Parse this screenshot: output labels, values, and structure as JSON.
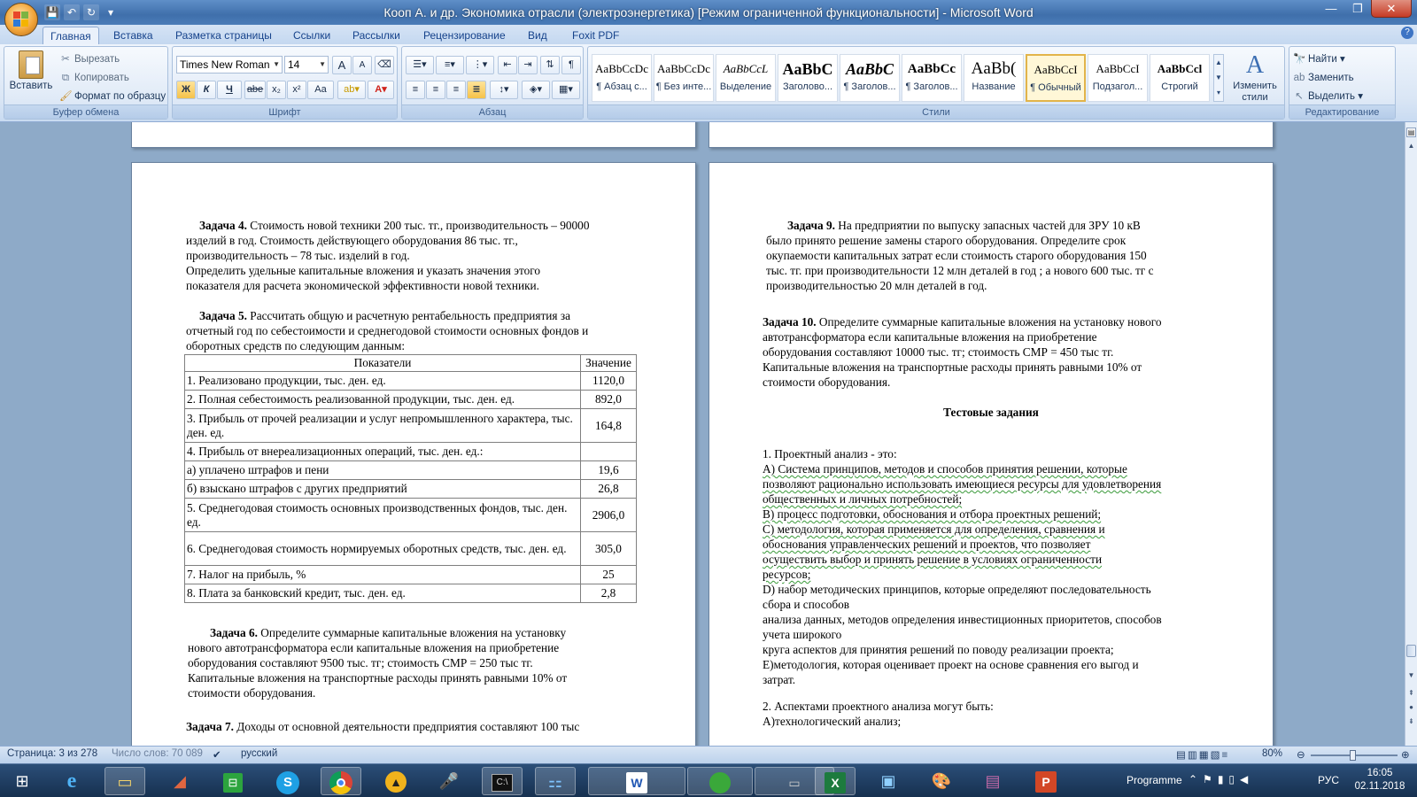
{
  "window": {
    "title": "Кооп А. и др. Экономика отрасли (электроэнергетика) [Режим ограниченной функциональности] - Microsoft Word",
    "minimize": "—",
    "restore": "❐",
    "close": "✕"
  },
  "tabs": [
    "Главная",
    "Вставка",
    "Разметка страницы",
    "Ссылки",
    "Рассылки",
    "Рецензирование",
    "Вид",
    "Foxit PDF"
  ],
  "ribbon": {
    "clipboard": {
      "label": "Буфер обмена",
      "paste": "Вставить",
      "cut": "Вырезать",
      "copy": "Копировать",
      "format_painter": "Формат по образцу"
    },
    "font": {
      "label": "Шрифт",
      "family": "Times New Roman",
      "size": "14",
      "bold": "Ж",
      "italic": "К",
      "underline": "Ч",
      "strike": "abe",
      "sub": "x₂",
      "sup": "x²",
      "case": "Aa",
      "grow": "A",
      "shrink": "A"
    },
    "paragraph": {
      "label": "Абзац"
    },
    "styles": {
      "label": "Стили",
      "items": [
        {
          "preview": "AaBbCcDc",
          "name": "¶ Абзац с..."
        },
        {
          "preview": "AaBbCcDc",
          "name": "¶ Без инте..."
        },
        {
          "preview": "AaBbCcL",
          "name": "Выделение"
        },
        {
          "preview": "AaBbC",
          "name": "Заголово..."
        },
        {
          "preview": "AaBbC",
          "name": "¶ Заголов..."
        },
        {
          "preview": "AaBbCc",
          "name": "¶ Заголов..."
        },
        {
          "preview": "AaBb(",
          "name": "Название"
        },
        {
          "preview": "AaBbCcI",
          "name": "¶ Обычный"
        },
        {
          "preview": "AaBbCcI",
          "name": "Подзагол..."
        },
        {
          "preview": "AaBbCcl",
          "name": "Строгий"
        }
      ],
      "change_styles": "Изменить стили"
    },
    "editing": {
      "label": "Редактирование",
      "find": "Найти",
      "replace": "Заменить",
      "select": "Выделить"
    }
  },
  "doc": {
    "left": {
      "t4_head": "Задача 4.",
      "t4_l1": " Стоимость новой техники 200 тыс. тг., производительность – 90000",
      "t4_l2": "изделий в год. Стоимость действующего оборудования 86 тыс. тг.,",
      "t4_l3": "производительность – 78 тыс. изделий в год.",
      "t4_l4": "Определить удельные капитальные вложения и указать значения этого",
      "t4_l5": "показателя для расчета экономической эффективности новой техники.",
      "t5_head": "Задача 5.",
      "t5_l1": " Рассчитать общую и расчетную рентабельность предприятия за",
      "t5_l2": "отчетный год по себестоимости и среднегодовой стоимости основных фондов и",
      "t5_l3": "оборотных средств по следующим данным:",
      "table": {
        "h1": "Показатели",
        "h2": "Значение",
        "rows": [
          [
            "1. Реализовано продукции, тыс. ден. ед.",
            "1120,0"
          ],
          [
            "2. Полная себестоимость реализованной продукции, тыс. ден. ед.",
            "892,0"
          ],
          [
            "3. Прибыль от прочей реализации и услуг непромышленного характера, тыс. ден. ед.",
            "164,8"
          ],
          [
            "4. Прибыль от внереализационных операций, тыс. ден. ед.:",
            ""
          ],
          [
            "а) уплачено штрафов и пени",
            "19,6"
          ],
          [
            "б) взыскано штрафов с других предприятий",
            "26,8"
          ],
          [
            "5. Среднегодовая стоимость основных производственных фондов, тыс. ден. ед.",
            "2906,0"
          ],
          [
            "6. Среднегодовая стоимость нормируемых оборотных средств, тыс. ден. ед.",
            "305,0"
          ],
          [
            "7. Налог на прибыль, %",
            "25"
          ],
          [
            "8. Плата за банковский кредит, тыс. ден. ед.",
            "2,8"
          ]
        ]
      },
      "t6_head": "Задача 6.",
      "t6_l1": " Определите суммарные капитальные вложения на установку",
      "t6_l2": "нового автотрансформатора если капитальные вложения на приобретение",
      "t6_l3": "оборудования составляют 9500 тыс. тг; стоимость СМР = 250 тыс тг.",
      "t6_l4": "Капитальные вложения на транспортные расходы принять равными 10% от",
      "t6_l5": "стоимости оборудования.",
      "t7_head": "Задача 7.",
      "t7_l1": " Доходы от основной деятельности предприятия составляют 100 тыс"
    },
    "right": {
      "t9_head": "Задача 9.",
      "t9_l1": " На предприятии по выпуску запасных частей для ЗРУ 10 кВ",
      "t9_l2": "было принято решение замены старого оборудования. Определите срок",
      "t9_l3": "окупаемости капитальных затрат если стоимость старого оборудования 150",
      "t9_l4": "тыс. тг. при производительности 12 млн деталей в год ; а нового 600 тыс. тг с",
      "t9_l5": "производительностью 20 млн деталей в год.",
      "t10_head": "Задача 10.",
      "t10_l1": " Определите суммарные капитальные вложения на установку нового",
      "t10_l2": "автотрансформатора если капитальные вложения на приобретение",
      "t10_l3": "оборудования составляют 10000 тыс. тг; стоимость СМР = 450 тыс тг.",
      "t10_l4": "Капитальные вложения на транспортные расходы принять равными 10% от",
      "t10_l5": "стоимости оборудования.",
      "tests_title": "Тестовые задания",
      "q1": "1. Проектный  анализ - это:",
      "q1a1": "А) Система  принципов, методов и способов принятия решении, которые",
      "q1a2": "позволяют рационально использовать имеющиеся ресурсы для удовлетворения",
      "q1a3": "общественных и личных потребностей;",
      "q1b": "В) процесс подготовки, обоснования и отбора проектных решений;",
      "q1c1": "С) методология, которая применяется для определения, сравнения и",
      "q1c2": "обоснования управленческих решений  и  проектов,  что  позволяет",
      "q1c3": "осуществить  выбор  и  принять  решение  в  условиях ограниченности",
      "q1c4": "ресурсов;",
      "q1d1": "D) набор методических принципов, которые определяют последовательность",
      "q1d2": "сбора и способов",
      "q1d3": "анализа данных, методов определения инвестиционных приоритетов, способов",
      "q1d4": "учета широкого",
      "q1d5": "круга аспектов для принятия решений по поводу реализации проекта;",
      "q1e1": "Е)методология, которая оценивает проект на основе сравнения его выгод и",
      "q1e2": "затрат.",
      "q2": "2. Аспектами проектного анализа могут быть:",
      "q2a": "А)технологический анализ;"
    }
  },
  "status": {
    "page": "Страница: 3 из 278",
    "words": "Число слов: 70 089",
    "lang": "русский",
    "zoom": "80%"
  },
  "taskbar": {
    "programme": "Programme",
    "lang": "РУС",
    "time": "16:05",
    "date": "02.11.2018"
  },
  "colors": {
    "accent": "#4a7cb8",
    "ribbon": "#dae6f5",
    "selected_style": "#e2b44a"
  }
}
